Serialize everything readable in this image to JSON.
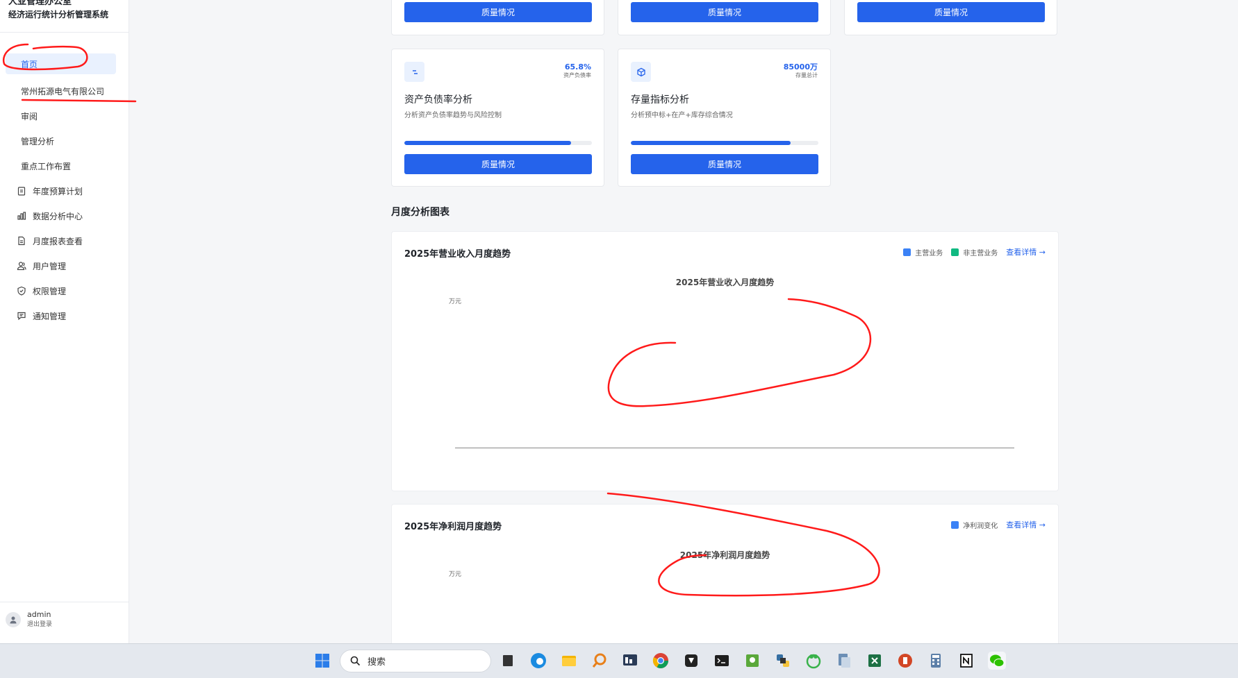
{
  "brand": {
    "line1": "人亚管理办公室",
    "line2": "经济运行统计分析管理系统"
  },
  "nav": [
    {
      "label": "首页",
      "icon": "",
      "active": true
    },
    {
      "label": "常州拓源电气有限公司",
      "icon": ""
    },
    {
      "label": "审阅",
      "icon": ""
    },
    {
      "label": "管理分析",
      "icon": ""
    },
    {
      "label": "重点工作布置",
      "icon": ""
    },
    {
      "label": "年度预算计划",
      "icon": "clipboard-icon"
    },
    {
      "label": "数据分析中心",
      "icon": "bar-chart-icon"
    },
    {
      "label": "月度报表查看",
      "icon": "document-icon"
    },
    {
      "label": "用户管理",
      "icon": "users-icon"
    },
    {
      "label": "权限管理",
      "icon": "shield-icon"
    },
    {
      "label": "通知管理",
      "icon": "message-icon"
    }
  ],
  "user": {
    "name": "admin",
    "logout": "退出登录"
  },
  "cards": {
    "quality_label": "质量情况",
    "asset": {
      "title": "资产负债率分析",
      "desc": "分析资产负债率趋势与风险控制",
      "value": "65.8%",
      "sub": "资产负债率",
      "progress": 0.89,
      "icon": "scale-icon"
    },
    "stock": {
      "title": "存量指标分析",
      "desc": "分析预中标+在产+库存综合情况",
      "value": "85000万",
      "sub": "存量总计",
      "progress": 0.85,
      "icon": "cube-icon"
    }
  },
  "section_title": "月度分析图表",
  "charts": {
    "revenue": {
      "title": "2025年营业收入月度趋势",
      "chart_title": "2025年营业收入月度趋势",
      "unit": "万元",
      "legend": [
        "主营业务",
        "非主营业务"
      ],
      "colors": [
        "#3b82f6",
        "#10b981"
      ],
      "more": "查看详情 →"
    },
    "profit": {
      "title": "2025年净利润月度趋势",
      "chart_title": "2025年净利润月度趋势",
      "unit": "万元",
      "legend": [
        "净利润变化"
      ],
      "colors": [
        "#3b82f6"
      ],
      "more": "查看详情 →"
    }
  },
  "taskbar": {
    "search_placeholder": "搜索"
  }
}
